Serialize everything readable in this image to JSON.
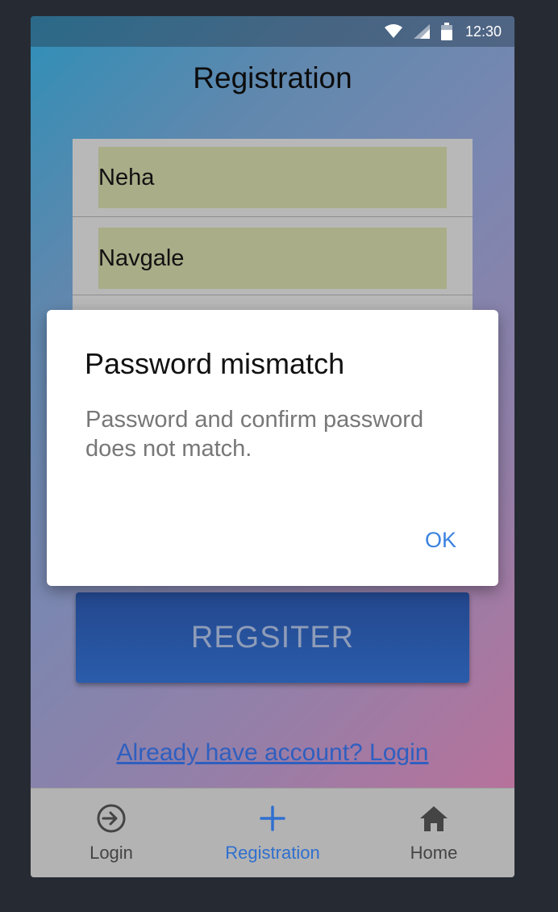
{
  "status_bar": {
    "time": "12:30",
    "icons": [
      "wifi-icon",
      "cell-signal-icon",
      "battery-icon"
    ]
  },
  "page": {
    "title": "Registration"
  },
  "form": {
    "first_name_value": "Neha",
    "last_name_value": "Navgale"
  },
  "register_button": {
    "label": "REGSITER"
  },
  "login_link": {
    "text": "Already have account? Login"
  },
  "tab_bar": {
    "tabs": [
      {
        "label": "Login",
        "icon": "login-icon",
        "active": false
      },
      {
        "label": "Registration",
        "icon": "plus-icon",
        "active": true
      },
      {
        "label": "Home",
        "icon": "home-icon",
        "active": false
      }
    ]
  },
  "dialog": {
    "title": "Password mismatch",
    "message": "Password and confirm password does not match.",
    "ok_label": "OK"
  },
  "colors": {
    "accent": "#2f6fcf",
    "dialog_ok": "#3b82e0",
    "field_bg": "#a9ad88",
    "button_bg": "#2a5cab",
    "tab_bar_bg": "#b3b3b3"
  }
}
